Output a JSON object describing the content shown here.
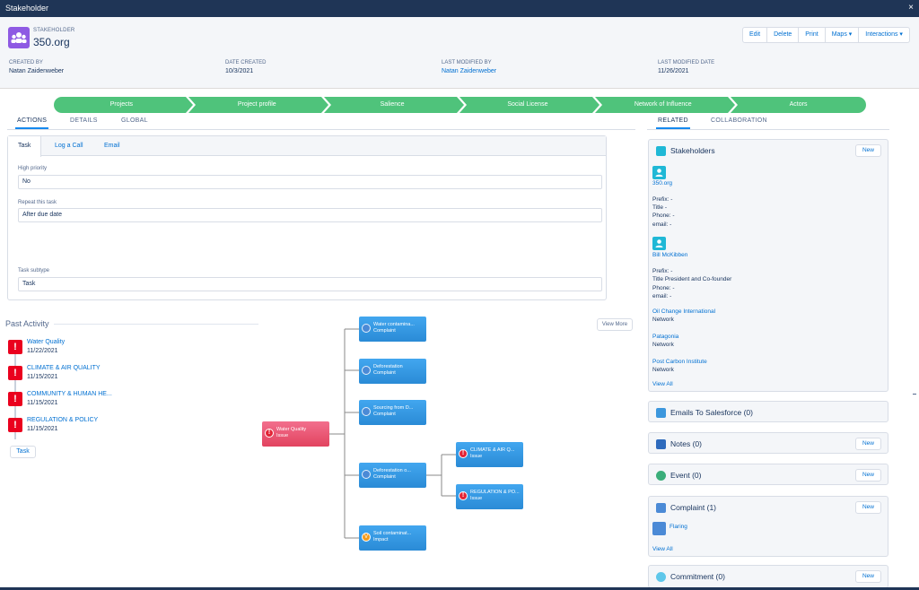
{
  "window": {
    "title": "Stakeholder",
    "close_glyph": "×"
  },
  "record": {
    "type_label": "STAKEHOLDER",
    "name": "350.org",
    "buttons": [
      "Edit",
      "Delete",
      "Print",
      "Maps ▾",
      "Interactions ▾"
    ],
    "meta": [
      {
        "label": "CREATED BY",
        "value": "Natan Zaidenweber"
      },
      {
        "label": "DATE CREATED",
        "value": "10/3/2021"
      },
      {
        "label": "LAST MODIFIED BY",
        "value": "Natan Zaidenweber"
      },
      {
        "label": "LAST MODIFIED DATE",
        "value": "11/26/2021"
      }
    ]
  },
  "path": {
    "color": "#4fc37b",
    "steps": [
      "Projects",
      "Project profile",
      "Salience",
      "Social License",
      "Network of Influence",
      "Actors"
    ]
  },
  "left_tabs": [
    "ACTIONS",
    "DETAILS",
    "GLOBAL"
  ],
  "action_panel": {
    "tabs": [
      "Task",
      "Log a Call",
      "Email"
    ],
    "fields": [
      {
        "label": "High priority",
        "value": "No"
      },
      {
        "label": "Repeat this task",
        "value": "After due date"
      },
      {
        "label": "Task subtype",
        "value": "Task"
      }
    ]
  },
  "past_activity": {
    "title": "Past Activity",
    "items": [
      {
        "name": "Water Quality",
        "date": "11/22/2021"
      },
      {
        "name": "CLIMATE & AIR QUALITY",
        "date": "11/15/2021"
      },
      {
        "name": "COMMUNITY & HUMAN HE...",
        "date": "11/15/2021"
      },
      {
        "name": "REGULATION & POLICY",
        "date": "11/15/2021"
      }
    ],
    "task_button": "Task",
    "view_more": "View More"
  },
  "tree": {
    "root": {
      "title": "Water Quality",
      "subtitle": "Issue"
    },
    "children": [
      {
        "title": "Water contamina...",
        "subtitle": "Complaint"
      },
      {
        "title": "Deforestation",
        "subtitle": "Complaint"
      },
      {
        "title": "Sourcing from D...",
        "subtitle": "Complaint"
      },
      {
        "title": "Deforestation o...",
        "subtitle": "Complaint"
      },
      {
        "title": "Soil contaminat...",
        "subtitle": "Impact"
      }
    ],
    "grandchildren": [
      {
        "title": "CLIMATE & AIR Q...",
        "subtitle": "Issue"
      },
      {
        "title": "REGULATION & PO...",
        "subtitle": "Issue"
      }
    ],
    "warn_glyph": "!",
    "impact_glyph": "V"
  },
  "right_tabs": [
    "RELATED",
    "COLLABORATION"
  ],
  "related": {
    "new_label": "New",
    "stakeholders": {
      "title": "Stakeholders",
      "people": [
        {
          "name": "350.org",
          "prefix": "Prefix: -",
          "title": "Title -",
          "phone": "Phone: -",
          "email": "email: -"
        },
        {
          "name": "Bill McKibben",
          "prefix": "Prefix: -",
          "title": "Title President and Co-founder",
          "phone": "Phone: -",
          "email": "email: -"
        }
      ],
      "networks": [
        {
          "name": "Oil Change International",
          "type": "Network"
        },
        {
          "name": "Patagonia",
          "type": "Network"
        },
        {
          "name": "Post Carbon Institute",
          "type": "Network"
        }
      ],
      "view_all": "View All"
    },
    "emails": {
      "title": "Emails To Salesforce (0)"
    },
    "notes": {
      "title": "Notes (0)"
    },
    "event": {
      "title": "Event (0)"
    },
    "complaint": {
      "title": "Complaint (1)",
      "item": "Flaring",
      "view_all": "View All"
    },
    "commitment": {
      "title": "Commitment (0)"
    }
  }
}
